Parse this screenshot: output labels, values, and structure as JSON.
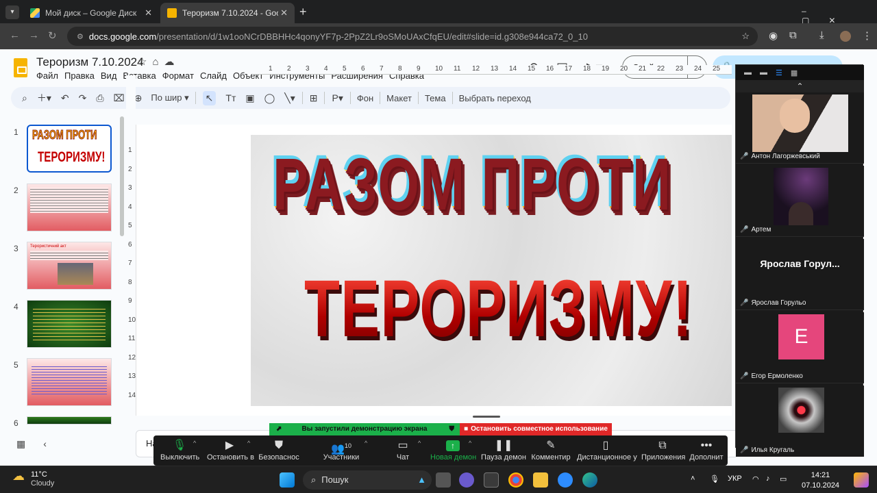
{
  "browser": {
    "tabs": [
      {
        "title": "Мой диск – Google Диск"
      },
      {
        "title": "Тероризм 7.10.2024 - Google П"
      }
    ],
    "url_host": "docs.google.com",
    "url_path": "/presentation/d/1w1ooNCrDBBHHc4qonyYF7p-2PpZ2Lr9oSMoUAxCfqEU/edit#slide=id.g308e944ca72_0_10",
    "new_tab": "+"
  },
  "slides": {
    "title": "Тероризм 7.10.2024",
    "menu": [
      "Файл",
      "Правка",
      "Вид",
      "Вставка",
      "Формат",
      "Слайд",
      "Объект",
      "Инструменты",
      "Расширения",
      "Справка"
    ],
    "slideshow_button": "Слайд-шоу",
    "zoom_label": "По шир",
    "toolbar_text": [
      "Фон",
      "Макет",
      "Тема",
      "Выбрать переход"
    ],
    "notes_prefix": "На",
    "ruler_numbers": [
      "1",
      "2",
      "3",
      "4",
      "5",
      "6",
      "7",
      "8",
      "9",
      "10",
      "11",
      "12",
      "13",
      "14",
      "15",
      "16",
      "17",
      "18",
      "19",
      "20",
      "21",
      "22",
      "23",
      "24",
      "25"
    ],
    "vruler_numbers": [
      "1",
      "2",
      "3",
      "4",
      "5",
      "6",
      "7",
      "8",
      "9",
      "10",
      "11",
      "12",
      "13",
      "14"
    ],
    "thumbnails": [
      {
        "number": "1",
        "text": "РАЗОМ ПРОТИ ТЕРОРИЗМУ!"
      },
      {
        "number": "2",
        "text": ""
      },
      {
        "number": "3",
        "text": "Терористичний акт"
      },
      {
        "number": "4",
        "text": ""
      },
      {
        "number": "5",
        "text": ""
      },
      {
        "number": "6",
        "text": ""
      }
    ],
    "current_slide": {
      "line1": "РАЗОМ ПРОТИ",
      "line2": "ТЕРОРИЗМУ!"
    }
  },
  "zoom": {
    "participants": [
      {
        "name": "Антон Лагоржевський"
      },
      {
        "name": "Артем"
      },
      {
        "name": "Ярослав Горульо",
        "display": "Ярослав  Горул..."
      },
      {
        "name": "Егор Ермоленко",
        "initial": "E"
      },
      {
        "name": "Илья Кругаль"
      }
    ],
    "share_banner": "Вы запустили демонстрацию экрана",
    "stop_banner": "Остановить совместное использование",
    "participants_count": "10",
    "controls": [
      "Выключить",
      "Остановить в",
      "Безопаснос",
      "Участники",
      "Чат",
      "Новая демон",
      "Пауза демон",
      "Комментир",
      "Дистанционное у",
      "Приложения",
      "Дополнит"
    ]
  },
  "taskbar": {
    "temperature": "11°C",
    "weather": "Cloudy",
    "search": "Пошук",
    "lang": "УКР",
    "time": "14:21",
    "date": "07.10.2024"
  }
}
